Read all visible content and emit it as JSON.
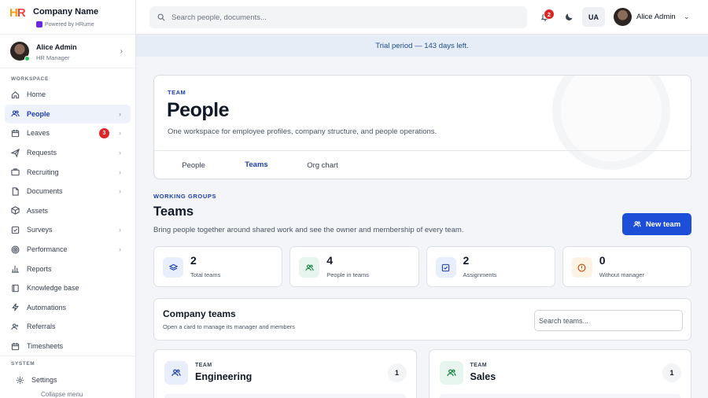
{
  "brand": {
    "logo": "HR",
    "name": "Company Name",
    "powered": "Powered by HRume"
  },
  "sidebar_user": {
    "name": "Alice Admin",
    "role": "HR Manager"
  },
  "sections": {
    "workspace": "WORKSPACE",
    "system": "SYSTEM"
  },
  "nav": [
    {
      "label": "Home",
      "icon": "home-icon"
    },
    {
      "label": "People",
      "icon": "people-icon",
      "active": true
    },
    {
      "label": "Leaves",
      "icon": "calendar-icon",
      "badge": "3"
    },
    {
      "label": "Requests",
      "icon": "send-icon"
    },
    {
      "label": "Recruiting",
      "icon": "briefcase-icon"
    },
    {
      "label": "Documents",
      "icon": "document-icon"
    },
    {
      "label": "Assets",
      "icon": "box-icon"
    },
    {
      "label": "Surveys",
      "icon": "checkbox-icon"
    },
    {
      "label": "Performance",
      "icon": "target-icon"
    },
    {
      "label": "Reports",
      "icon": "bar-chart-icon"
    },
    {
      "label": "Knowledge base",
      "icon": "book-icon"
    },
    {
      "label": "Automations",
      "icon": "lightning-icon"
    },
    {
      "label": "Referrals",
      "icon": "referral-icon"
    },
    {
      "label": "Timesheets",
      "icon": "calendar-icon"
    }
  ],
  "settings_label": "Settings",
  "collapse_label": "Collapse menu",
  "topbar": {
    "search_placeholder": "Search people, documents...",
    "notifications": "2",
    "language": "UA",
    "user_name": "Alice Admin"
  },
  "trial_text": "Trial period — 143 days left.",
  "hero": {
    "tag": "TEAM",
    "title": "People",
    "description": "One workspace for employee profiles, company structure, and people operations.",
    "tabs": [
      "People",
      "Teams",
      "Org chart"
    ],
    "active_tab": "Teams"
  },
  "section": {
    "tag": "WORKING GROUPS",
    "title": "Teams",
    "description": "Bring people together around shared work and see the owner and membership of every team.",
    "new_button": "New team"
  },
  "stats": [
    {
      "value": "2",
      "label": "Total teams",
      "icon": "layers-icon"
    },
    {
      "value": "4",
      "label": "People in teams",
      "icon": "people-icon"
    },
    {
      "value": "2",
      "label": "Assignments",
      "icon": "checkbox-icon"
    },
    {
      "value": "0",
      "label": "Without manager",
      "icon": "info-icon"
    }
  ],
  "company": {
    "title": "Company teams",
    "subtitle": "Open a card to manage its manager and members",
    "search_placeholder": "Search teams..."
  },
  "teams": [
    {
      "tag": "TEAM",
      "name": "Engineering",
      "count": "1"
    },
    {
      "tag": "TEAM",
      "name": "Sales",
      "count": "1"
    }
  ],
  "colors": {
    "accent": "#1d4ed8",
    "badge": "#dc2626",
    "trial_bg": "#e7edf6"
  }
}
